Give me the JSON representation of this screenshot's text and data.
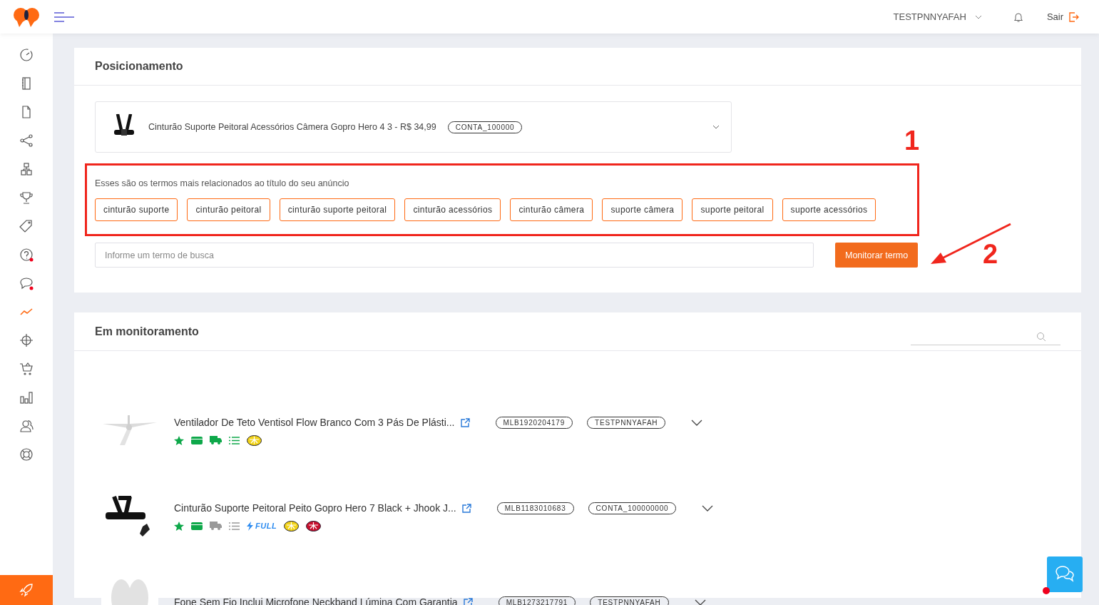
{
  "header": {
    "account": "TESTPNNYAFAH",
    "logout": "Sair"
  },
  "sidebar": {
    "items": [
      {
        "kind": "gauge",
        "selected": false,
        "alert": false
      },
      {
        "kind": "notebook",
        "selected": false,
        "alert": false
      },
      {
        "kind": "file",
        "selected": false,
        "alert": false
      },
      {
        "kind": "share",
        "selected": false,
        "alert": false
      },
      {
        "kind": "blocks",
        "selected": false,
        "alert": false
      },
      {
        "kind": "trophy",
        "selected": false,
        "alert": false
      },
      {
        "kind": "tag",
        "selected": false,
        "alert": false
      },
      {
        "kind": "help",
        "selected": false,
        "alert": true
      },
      {
        "kind": "chat",
        "selected": false,
        "alert": true
      },
      {
        "kind": "trend",
        "selected": true,
        "alert": false
      },
      {
        "kind": "target",
        "selected": false,
        "alert": false
      },
      {
        "kind": "cart",
        "selected": false,
        "alert": false
      },
      {
        "kind": "bars",
        "selected": false,
        "alert": false
      },
      {
        "kind": "users",
        "selected": false,
        "alert": false
      },
      {
        "kind": "lifebuoy",
        "selected": false,
        "alert": false
      }
    ]
  },
  "positioning": {
    "title": "Posicionamento",
    "product": {
      "name": "Cinturão Suporte Peitoral Acessórios Câmera Gopro Hero 4 3 - R$ 34,99",
      "account": "CONTA_100000"
    },
    "terms_hint": "Esses são os termos mais relacionados ao título do seu anúncio",
    "terms": [
      "cinturão suporte",
      "cinturão peitoral",
      "cinturão suporte peitoral",
      "cinturão acessórios",
      "cinturão câmera",
      "suporte câmera",
      "suporte peitoral",
      "suporte acessórios"
    ],
    "search": {
      "placeholder": "Informe um termo de busca"
    },
    "button": "Monitorar termo"
  },
  "annotations": [
    {
      "label": "1"
    },
    {
      "label": "2"
    }
  ],
  "monitoring": {
    "title": "Em monitoramento",
    "items": [
      {
        "title": "Ventilador De Teto Ventisol Flow Branco Com 3 Pás De Plásti...",
        "code": "MLB1920204179",
        "account": "TESTPNNYAFAH",
        "badges": [
          {
            "kind": "star",
            "on": true
          },
          {
            "kind": "card",
            "on": true
          },
          {
            "kind": "truck",
            "on": true
          },
          {
            "kind": "list",
            "on": true
          },
          {
            "kind": "medal",
            "color": "#f2d318"
          }
        ]
      },
      {
        "title": "Cinturão Suporte Peitoral Peito Gopro Hero 7 Black + Jhook J...",
        "code": "MLB1183010683",
        "account": "CONTA_100000000",
        "badges": [
          {
            "kind": "star",
            "on": true
          },
          {
            "kind": "card",
            "on": true
          },
          {
            "kind": "truck",
            "on": false
          },
          {
            "kind": "list",
            "on": false
          },
          {
            "kind": "full",
            "label": "FULL"
          },
          {
            "kind": "medal",
            "color": "#f2d318"
          },
          {
            "kind": "medal",
            "color": "#c8102e"
          }
        ]
      },
      {
        "title": "Fone Sem Fio Inclui Microfone Neckband Lúmina Com Garantia",
        "code": "MLB1273217791",
        "account": "TESTPNNYAFAH"
      }
    ]
  }
}
